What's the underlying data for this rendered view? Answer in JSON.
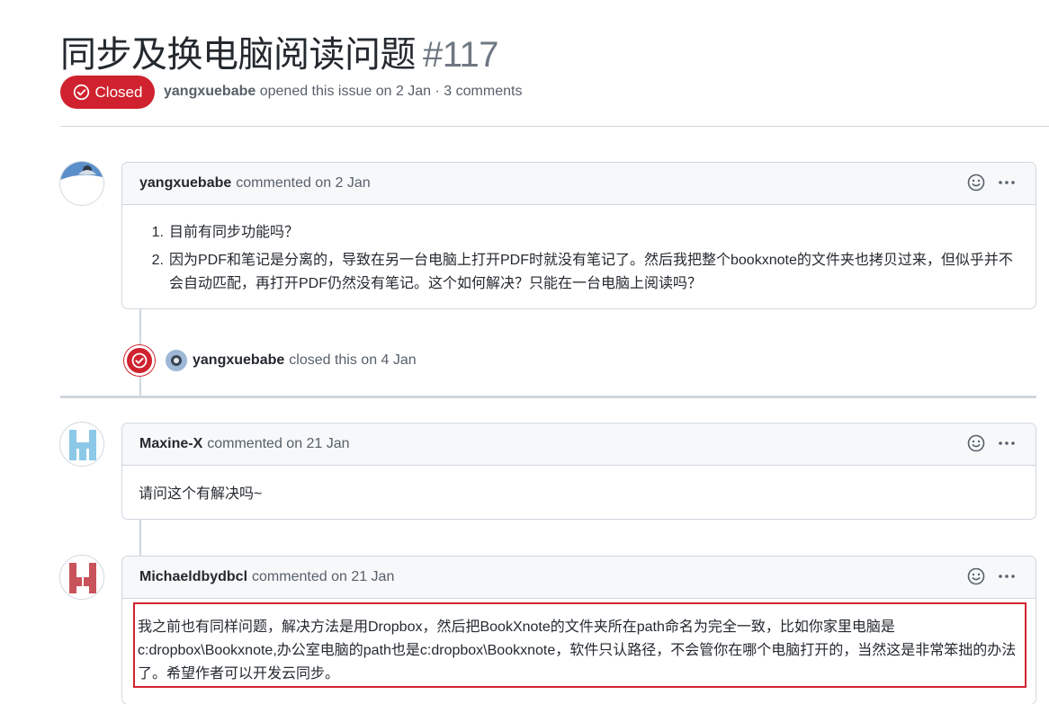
{
  "issue": {
    "title": "同步及换电脑阅读问题",
    "number": "#117",
    "state_label": "Closed",
    "author": "yangxuebabe",
    "meta_text": "opened this issue on 2 Jan · 3 comments"
  },
  "comments": [
    {
      "author": "yangxuebabe",
      "action": "commented on 2 Jan",
      "items": [
        "目前有同步功能吗？",
        "因为PDF和笔记是分离的，导致在另一台电脑上打开PDF时就没有笔记了。然后我把整个bookxnote的文件夹也拷贝过来，但似乎并不会自动匹配，再打开PDF仍然没有笔记。这个如何解决？只能在一台电脑上阅读吗？"
      ]
    },
    {
      "author": "Maxine-X",
      "action": "commented on 21 Jan",
      "body": "请问这个有解决吗~"
    },
    {
      "author": "Michaeldbydbcl",
      "action": "commented on 21 Jan",
      "body": "我之前也有同样问题，解决方法是用Dropbox，然后把BookXnote的文件夹所在path命名为完全一致，比如你家里电脑是c:dropbox\\Bookxnote,办公室电脑的path也是c:dropbox\\Bookxnote，软件只认路径，不会管你在哪个电脑打开的，当然这是非常笨拙的办法了。希望作者可以开发云同步。"
    }
  ],
  "event": {
    "actor": "yangxuebabe",
    "text": "closed this on 4 Jan"
  },
  "colors": {
    "closed_red": "#cf222e",
    "highlight_red": "#d1242f",
    "border": "#d0d7de",
    "header_bg": "#f6f8fa",
    "muted_text": "#57606a"
  },
  "icons": {
    "state": "check-circle-icon",
    "reaction": "smiley-icon",
    "menu": "kebab-horizontal-icon"
  }
}
